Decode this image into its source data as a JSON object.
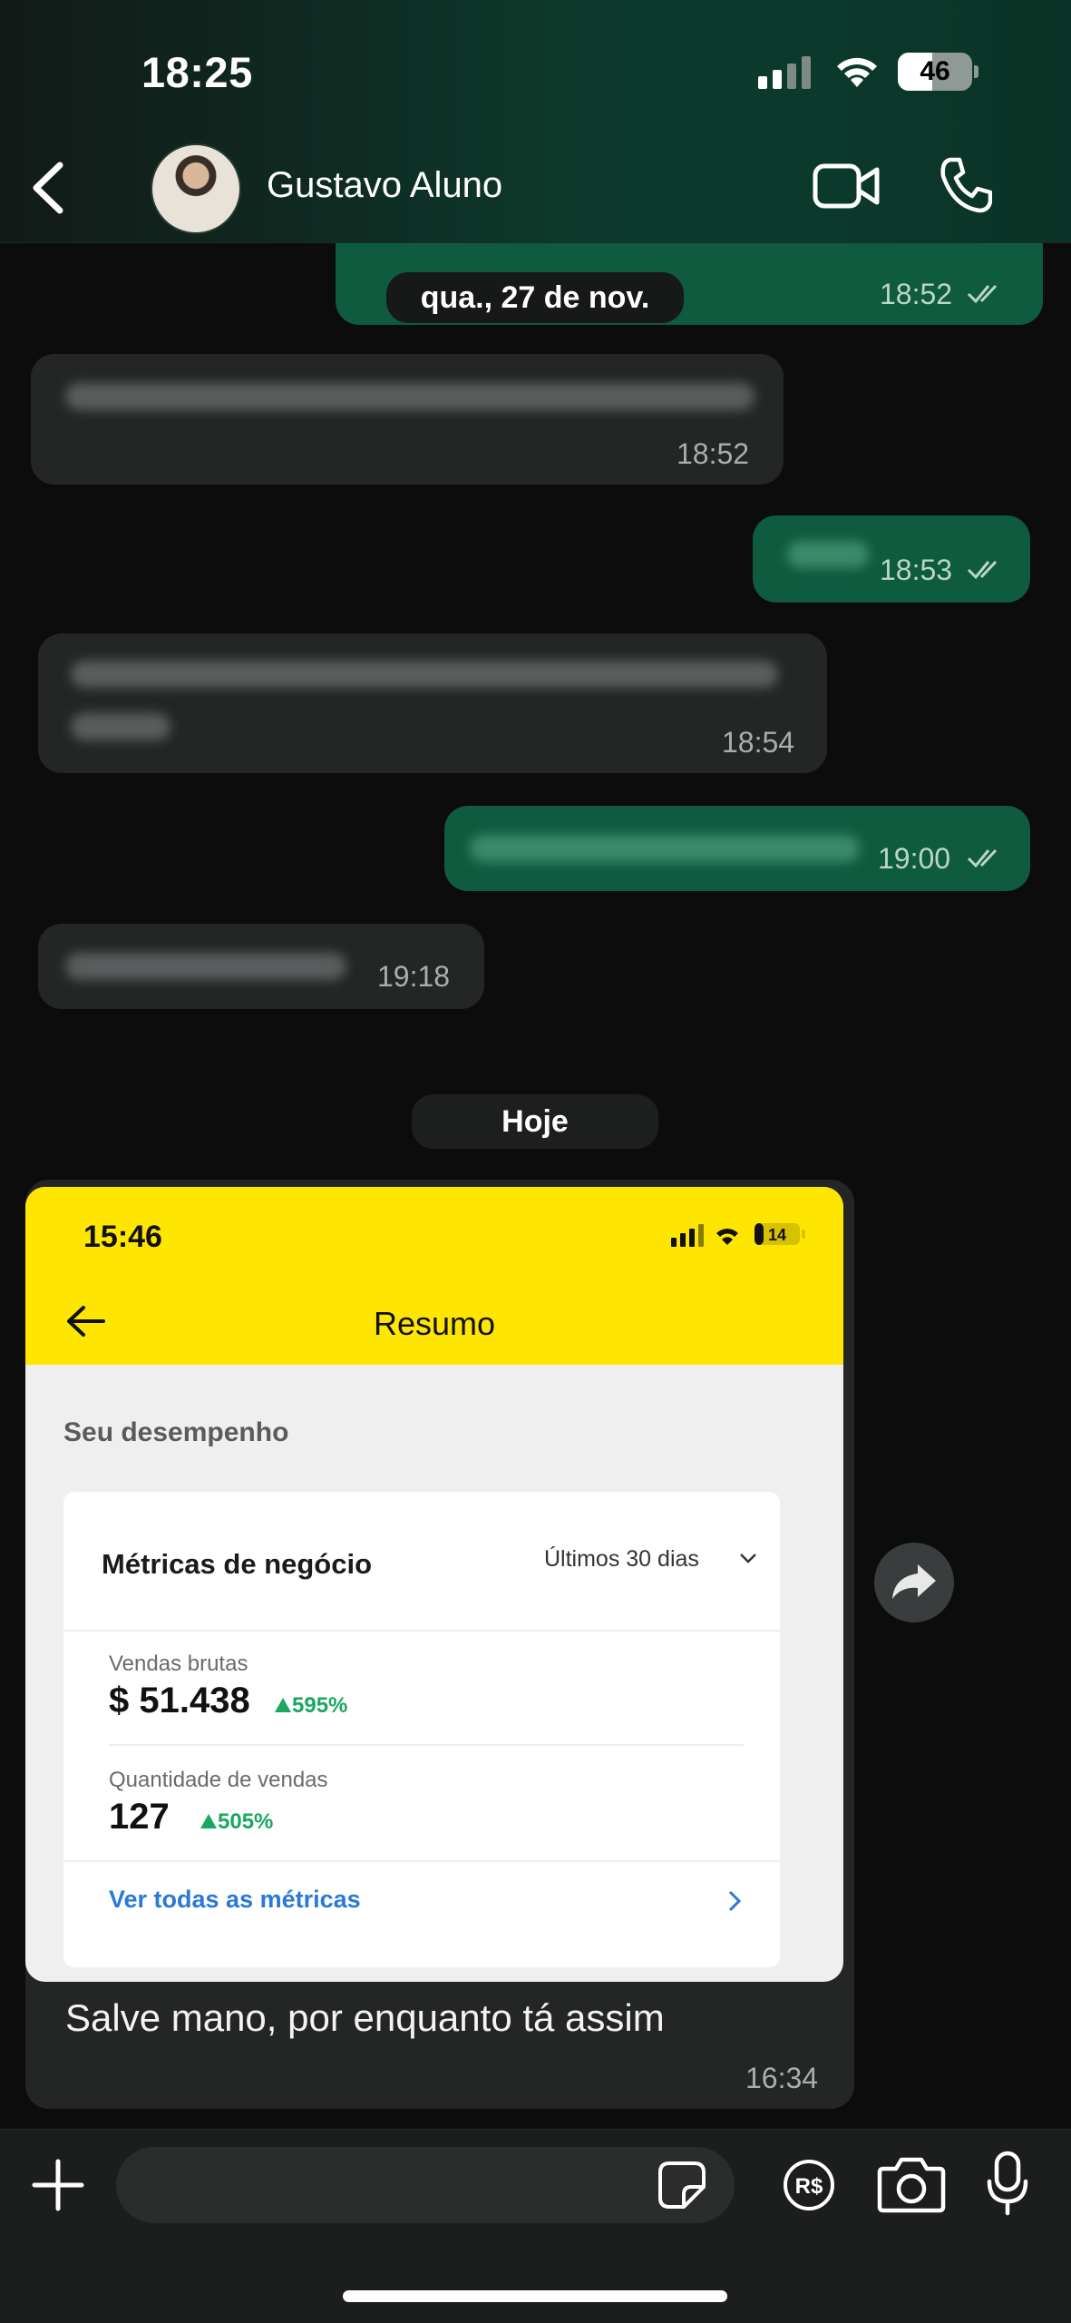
{
  "status_bar": {
    "time": "18:25",
    "battery": "46",
    "battery_level": 0.46
  },
  "header": {
    "contact_name": "Gustavo Aluno"
  },
  "messages": [
    {
      "time": "18:52",
      "direction": "out"
    },
    {
      "time": "18:52",
      "direction": "in"
    },
    {
      "time": "18:53",
      "direction": "out"
    },
    {
      "time": "18:54",
      "direction": "in"
    },
    {
      "time": "19:00",
      "direction": "out"
    },
    {
      "time": "19:18",
      "direction": "in"
    }
  ],
  "date_separators": {
    "previous": "qua., 27 de nov.",
    "today": "Hoje"
  },
  "shared_screenshot": {
    "status_time": "15:46",
    "battery": "14",
    "title": "Resumo",
    "section": "Seu desempenho",
    "card_title": "Métricas de negócio",
    "period": "Últimos 30 dias",
    "metric1_label": "Vendas brutas",
    "metric1_value": "$ 51.438",
    "metric1_change": "595%",
    "metric2_label": "Quantidade de vendas",
    "metric2_value": "127",
    "metric2_change": "505%",
    "link": "Ver todas as métricas"
  },
  "last_message": {
    "caption": "Salve mano, por enquanto tá assim",
    "time": "16:34"
  },
  "input": {
    "placeholder": ""
  },
  "colors": {
    "outgoing_bubble": "#0f5b40",
    "incoming_bubble": "#242626",
    "accent_yellow": "#ffe600",
    "positive_green": "#1aa760",
    "link_blue": "#2a79d6"
  }
}
